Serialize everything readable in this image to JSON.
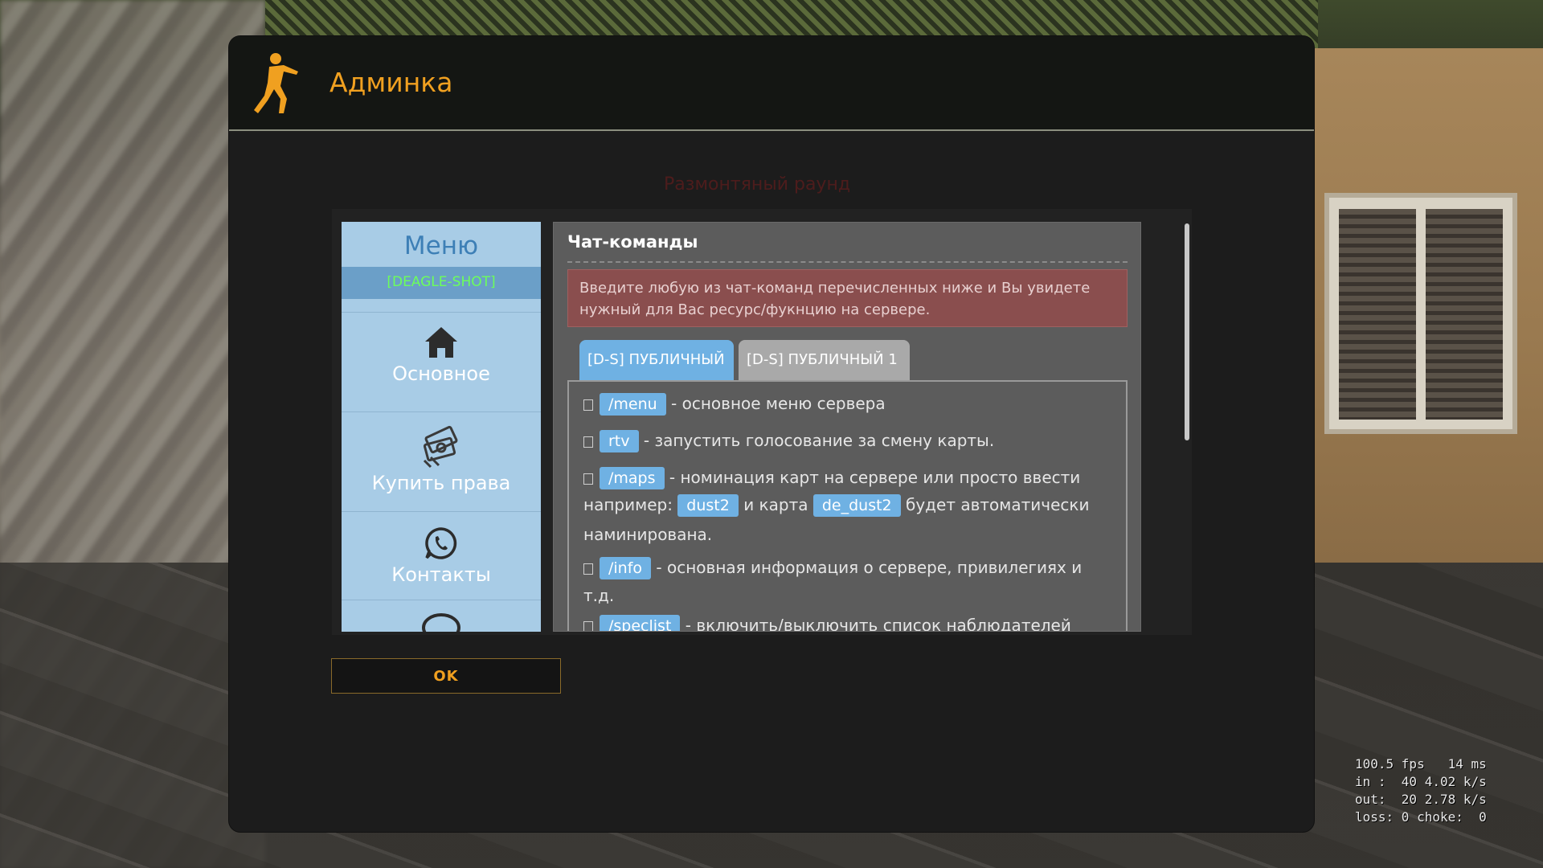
{
  "window": {
    "title": "Админка",
    "logo_icon": "counter-terrorist-icon",
    "faded_hud_text": "Размонтяный раунд"
  },
  "sidebar": {
    "header": "Меню",
    "server_tag": "[DEAGLE-SHOT]",
    "items": [
      {
        "label": "Основное",
        "icon": "home-icon"
      },
      {
        "label": "Купить права",
        "icon": "money-icon"
      },
      {
        "label": "Контакты",
        "icon": "whatsapp-icon"
      },
      {
        "label": "",
        "icon": "chat-icon"
      }
    ]
  },
  "content": {
    "title": "Чат-команды",
    "alert": "Введите любую из чат-команд перечисленных ниже и Вы увидете нужный для Вас ресурс/фукнцию на сервере.",
    "tabs": [
      {
        "label": "[D-S] ПУБЛИЧНЫЙ",
        "active": true
      },
      {
        "label": "[D-S] ПУБЛИЧНЫЙ 1",
        "active": false
      }
    ],
    "commands": [
      {
        "tag": "/menu",
        "text": "- основное меню сервера"
      },
      {
        "tag": "rtv",
        "text": "- запустить голосование за смену карты."
      },
      {
        "tag": "/maps",
        "text": "- номинация карт на сервере или просто ввести",
        "line2_prefix": "например:",
        "example1": "dust2",
        "mid": "и карта",
        "example2": "de_dust2",
        "line2_suffix": "будет автоматически",
        "line3": "наминирована."
      },
      {
        "tag": "/info",
        "text": "- основная информация о сервере, привилегиях и",
        "line2": "т.д."
      },
      {
        "tag": "/speclist",
        "text": "- включить/выключить список наблюдателей"
      }
    ]
  },
  "ok_button": {
    "label": "OK"
  },
  "netgraph": {
    "line1": "100.5 fps   14 ms",
    "line2": "in :  40 4.02 k/s",
    "line3": "out:  20 2.78 k/s",
    "line4": "loss: 0 choke:  0"
  },
  "colors": {
    "accent_orange": "#f0a020",
    "sidebar_blue": "#a8cce6",
    "tag_blue": "#6fb1e3",
    "server_tag_green": "#6cff5a",
    "alert_red": "#8a4e4e"
  }
}
